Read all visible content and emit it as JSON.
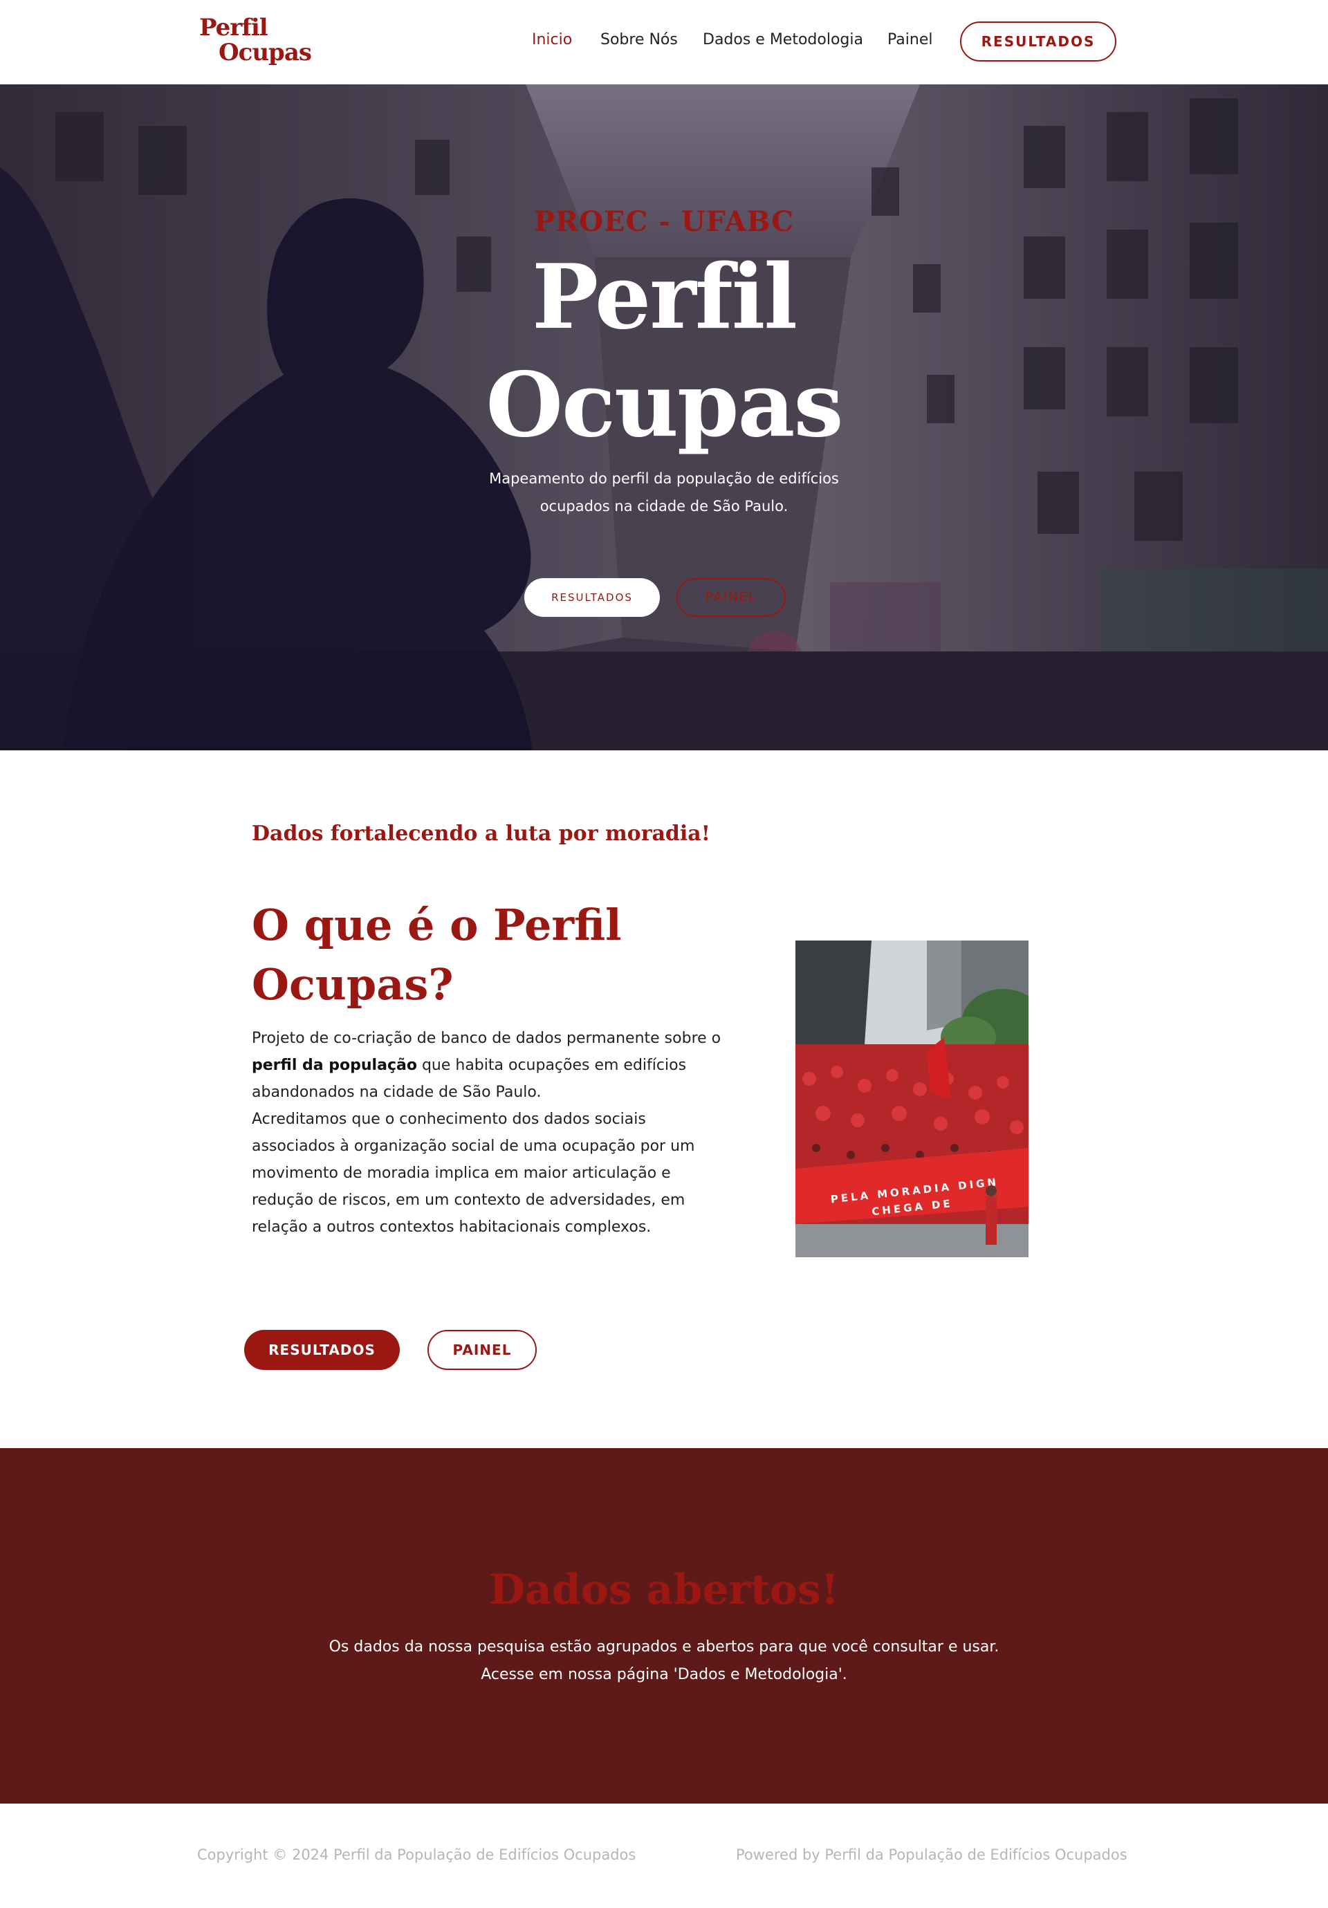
{
  "header": {
    "logo_line1": "Perfil",
    "logo_line2": "Ocupas",
    "nav": [
      {
        "label": "Inicio",
        "active": true
      },
      {
        "label": "Sobre Nós"
      },
      {
        "label": "Dados e Metodologia"
      },
      {
        "label": "Painel"
      }
    ],
    "cta_label": "RESULTADOS"
  },
  "hero": {
    "eyebrow": "PROEC - UFABC",
    "title_line1": "Perfil",
    "title_line2": "Ocupas",
    "subtitle": "Mapeamento do perfil da população de edifícios ocupados na cidade de São Paulo.",
    "button_primary": "RESULTADOS",
    "button_secondary": "PAINEL"
  },
  "about": {
    "kicker": "Dados fortalecendo a luta por moradia!",
    "title": "O que é o Perfil Ocupas?",
    "paragraph1_before": "Projeto de co-criação de banco de dados permanente sobre o ",
    "paragraph1_bold": "perfil da população",
    "paragraph1_after": " que habita ocupações em edifícios abandonados na cidade de São Paulo.",
    "paragraph2": "Acreditamos que o conhecimento dos dados sociais associados à organização social de uma ocupação por um movimento de moradia implica em maior articulação e redução de riscos, em um contexto de adversidades, em relação a outros contextos habitacionais complexos.",
    "banner_text_line1": "PELA MORADIA DIGN",
    "banner_text_line2": "CHEGA DE",
    "button_results": "RESULTADOS",
    "button_panel": "PAINEL"
  },
  "open_data": {
    "title": "Dados abertos!",
    "line1": "Os dados da nossa pesquisa estão agrupados e abertos para que você consultar e usar.",
    "line2": "Acesse em nossa página 'Dados e Metodologia'."
  },
  "footer": {
    "copyright": "Copyright © 2024 Perfil da População de Edifícios Ocupados",
    "powered": "Powered by Perfil da População de Edifícios Ocupados"
  },
  "colors": {
    "brand_red": "#9b1711",
    "dark_band": "#5e1a19",
    "footer_text": "#b6b6b6"
  }
}
